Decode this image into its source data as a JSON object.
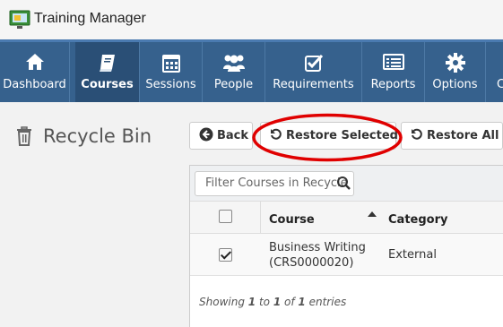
{
  "app": {
    "title": "Training Manager"
  },
  "nav": {
    "items": [
      {
        "label": "Dashboard",
        "icon": "home-icon"
      },
      {
        "label": "Courses",
        "icon": "book-icon",
        "active": true
      },
      {
        "label": "Sessions",
        "icon": "calendar-icon"
      },
      {
        "label": "People",
        "icon": "people-icon"
      },
      {
        "label": "Requirements",
        "icon": "checkbox-icon"
      },
      {
        "label": "Reports",
        "icon": "report-icon"
      },
      {
        "label": "Options",
        "icon": "gear-icon"
      },
      {
        "label": "C",
        "icon": "truncated-icon"
      }
    ]
  },
  "page": {
    "title": "Recycle Bin",
    "icon": "trash-icon"
  },
  "toolbar": {
    "back_label": "Back",
    "restore_selected_label": "Restore Selected",
    "restore_all_label": "Restore All"
  },
  "filter": {
    "placeholder": "Filter Courses in Recycle"
  },
  "table": {
    "columns": [
      "Course",
      "Category"
    ],
    "rows": [
      {
        "checked": true,
        "course_line1": "Business Writing",
        "course_line2": "(CRS0000020)",
        "category": "External"
      }
    ]
  },
  "footer": {
    "showing": "Showing",
    "from": "1",
    "to_word": "to",
    "to": "1",
    "of_word": "of",
    "total": "1",
    "entries": "entries"
  },
  "colors": {
    "nav_bg": "#36618d",
    "nav_active": "#2a4f76",
    "highlight": "#e00000"
  }
}
